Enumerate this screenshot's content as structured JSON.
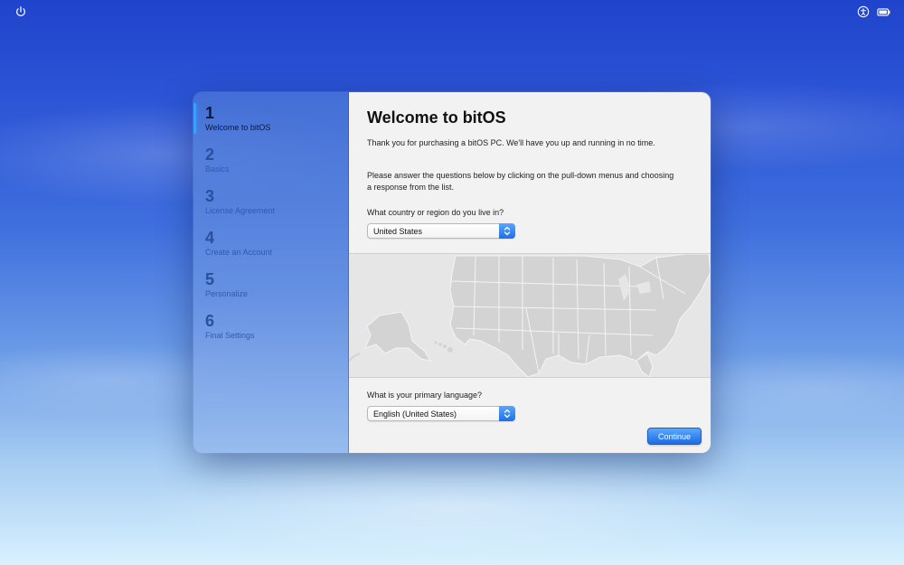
{
  "system_bar": {
    "left_icon": "power-icon",
    "right_icons": [
      "accessibility-icon",
      "battery-icon"
    ]
  },
  "sidebar": {
    "steps": [
      {
        "number": "1",
        "label": "Welcome to bitOS",
        "active": true
      },
      {
        "number": "2",
        "label": "Basics",
        "active": false
      },
      {
        "number": "3",
        "label": "License Agreement",
        "active": false
      },
      {
        "number": "4",
        "label": "Create an Account",
        "active": false
      },
      {
        "number": "5",
        "label": "Personalize",
        "active": false
      },
      {
        "number": "6",
        "label": "Final Settings",
        "active": false
      }
    ]
  },
  "main": {
    "title": "Welcome to bitOS",
    "intro": "Thank you for purchasing a bitOS PC. We'll have you up and running in no time.",
    "instructions": "Please answer the questions below by clicking on the pull-down menus and choosing a response from the list.",
    "country_question": "What country or region do you live in?",
    "country_value": "United States",
    "language_question": "What is your primary language?",
    "language_value": "English (United States)",
    "continue_label": "Continue"
  },
  "colors": {
    "accent": "#1e6ae0",
    "active_step_indicator": "#3aa0ff",
    "inactive_step_text": "#2e5cb0"
  }
}
